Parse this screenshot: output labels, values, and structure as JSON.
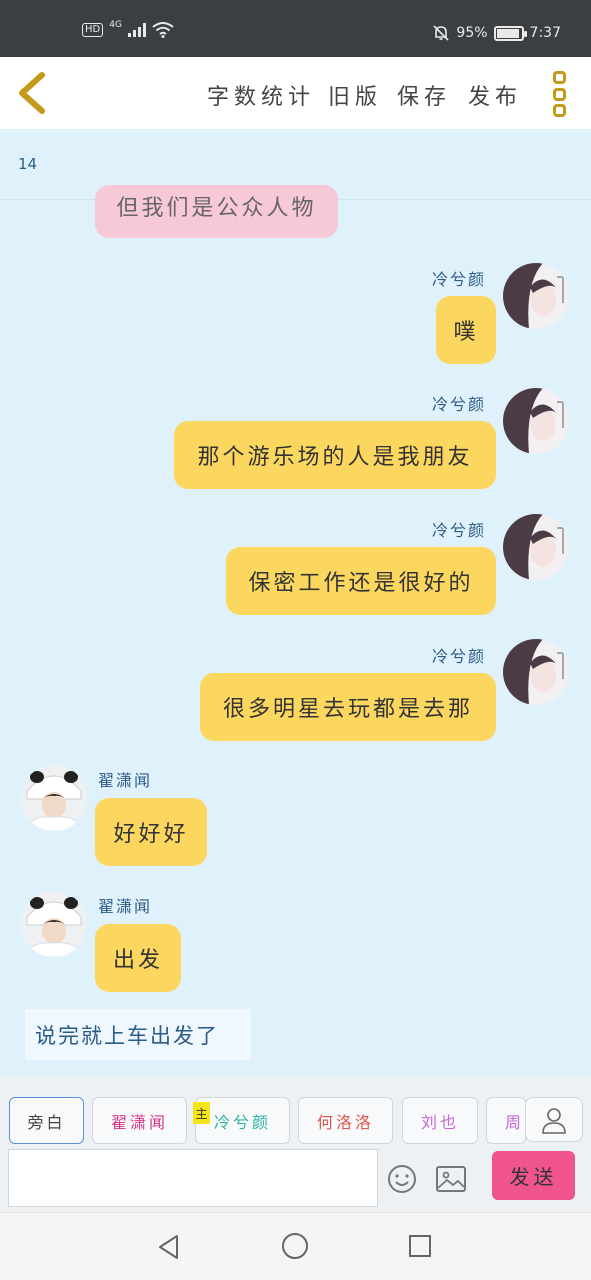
{
  "status_bar": {
    "hd": "HD",
    "network": "4G",
    "battery": "95%",
    "battery_level": 0.95,
    "time": "7:37"
  },
  "header": {
    "actions": [
      "字数统计",
      "旧版",
      "保存",
      "发布"
    ]
  },
  "chat": {
    "page_number": "14",
    "partial_message": "但我们是公众人物",
    "messages": [
      {
        "sender": "冷兮颜",
        "text": "噗"
      },
      {
        "sender": "冷兮颜",
        "text": "那个游乐场的人是我朋友"
      },
      {
        "sender": "冷兮颜",
        "text": "保密工作还是很好的"
      },
      {
        "sender": "冷兮颜",
        "text": "很多明星去玩都是去那"
      },
      {
        "sender": "翟潇闻",
        "text": "好好好"
      },
      {
        "sender": "翟潇闻",
        "text": "出发"
      }
    ],
    "narration": "说完就上车出发了"
  },
  "characters": [
    {
      "label": "旁白",
      "color": "#444444"
    },
    {
      "label": "翟潇闻",
      "color": "#d63384"
    },
    {
      "label": "冷兮颜",
      "color": "#2bb3a0"
    },
    {
      "label": "何洛洛",
      "color": "#e2574c"
    },
    {
      "label": "刘也",
      "color": "#c86bd8"
    },
    {
      "label": "周",
      "color": "#c86bd8"
    }
  ],
  "main_badge": "主",
  "send_label": "发送",
  "colors": {
    "accent_yellow": "#fbd760",
    "send_pink": "#f0548f",
    "chat_bg": "#dff1fb"
  }
}
